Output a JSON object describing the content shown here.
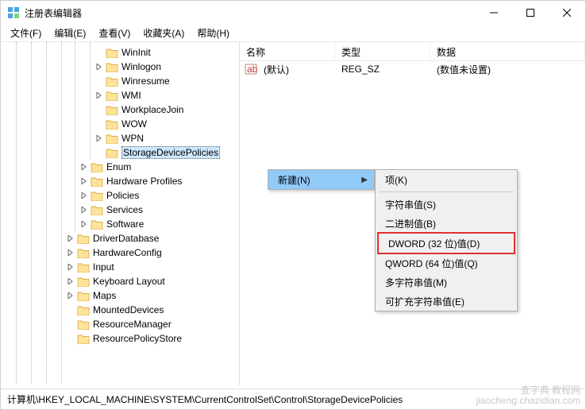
{
  "window": {
    "title": "注册表编辑器"
  },
  "menu": {
    "file": "文件(F)",
    "edit": "编辑(E)",
    "view": "查看(V)",
    "fav": "收藏夹(A)",
    "help": "帮助(H)"
  },
  "tree": [
    {
      "label": "WinInit",
      "indent": 118,
      "expander": ""
    },
    {
      "label": "Winlogon",
      "indent": 118,
      "expander": ">"
    },
    {
      "label": "Winresume",
      "indent": 118,
      "expander": ""
    },
    {
      "label": "WMI",
      "indent": 118,
      "expander": ">"
    },
    {
      "label": "WorkplaceJoin",
      "indent": 118,
      "expander": ""
    },
    {
      "label": "WOW",
      "indent": 118,
      "expander": ""
    },
    {
      "label": "WPN",
      "indent": 118,
      "expander": ">"
    },
    {
      "label": "StorageDevicePolicies",
      "indent": 118,
      "expander": "",
      "selected": true
    },
    {
      "label": "Enum",
      "indent": 99,
      "expander": ">"
    },
    {
      "label": "Hardware Profiles",
      "indent": 99,
      "expander": ">"
    },
    {
      "label": "Policies",
      "indent": 99,
      "expander": ">"
    },
    {
      "label": "Services",
      "indent": 99,
      "expander": ">"
    },
    {
      "label": "Software",
      "indent": 99,
      "expander": ">"
    },
    {
      "label": "DriverDatabase",
      "indent": 82,
      "expander": ">"
    },
    {
      "label": "HardwareConfig",
      "indent": 82,
      "expander": ">"
    },
    {
      "label": "Input",
      "indent": 82,
      "expander": ">"
    },
    {
      "label": "Keyboard Layout",
      "indent": 82,
      "expander": ">"
    },
    {
      "label": "Maps",
      "indent": 82,
      "expander": ">"
    },
    {
      "label": "MountedDevices",
      "indent": 82,
      "expander": ""
    },
    {
      "label": "ResourceManager",
      "indent": 82,
      "expander": ""
    },
    {
      "label": "ResourcePolicyStore",
      "indent": 82,
      "expander": ""
    }
  ],
  "list": {
    "cols": {
      "name": "名称",
      "type": "类型",
      "data": "数据"
    },
    "rows": [
      {
        "name": "(默认)",
        "type": "REG_SZ",
        "data": "(数值未设置)"
      }
    ]
  },
  "context_menu": {
    "parent_label": "新建(N)",
    "sub": [
      {
        "label": "项(K)"
      },
      {
        "sep": true
      },
      {
        "label": "字符串值(S)"
      },
      {
        "label": "二进制值(B)"
      },
      {
        "label": "DWORD (32 位)值(D)",
        "boxed": true
      },
      {
        "label": "QWORD (64 位)值(Q)"
      },
      {
        "label": "多字符串值(M)"
      },
      {
        "label": "可扩充字符串值(E)"
      }
    ]
  },
  "statusbar": {
    "path": "计算机\\HKEY_LOCAL_MACHINE\\SYSTEM\\CurrentControlSet\\Control\\StorageDevicePolicies"
  },
  "watermark": {
    "line1": "查字典 教程网",
    "line2": "jiaocheng.chazidian.com"
  }
}
